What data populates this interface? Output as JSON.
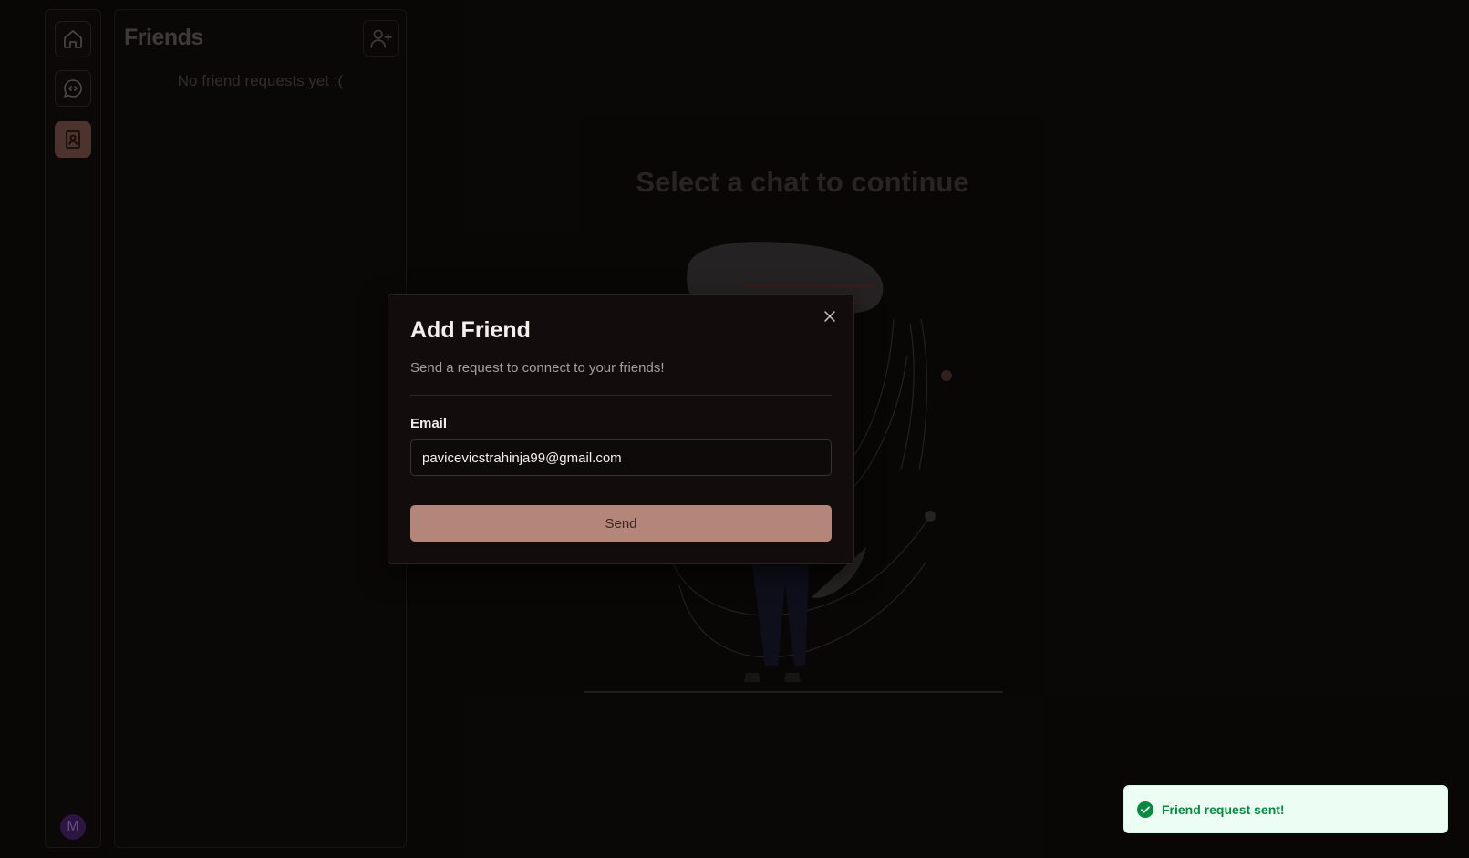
{
  "sidebar": {
    "avatar_initial": "M",
    "active_item": "friends",
    "active_color": "#5a3c36"
  },
  "friends": {
    "title": "Friends",
    "empty_text": "No friend requests yet :("
  },
  "main": {
    "empty_heading": "Select a chat to continue"
  },
  "modal": {
    "title": "Add Friend",
    "description": "Send a request to connect to your friends!",
    "email_label": "Email",
    "email_value": "pavicevicstrahinja99@gmail.com",
    "send_label": "Send",
    "accent": "#b48579"
  },
  "toast": {
    "message": "Friend request sent!",
    "icon": "check-circle-icon",
    "color": "#058a3f"
  }
}
